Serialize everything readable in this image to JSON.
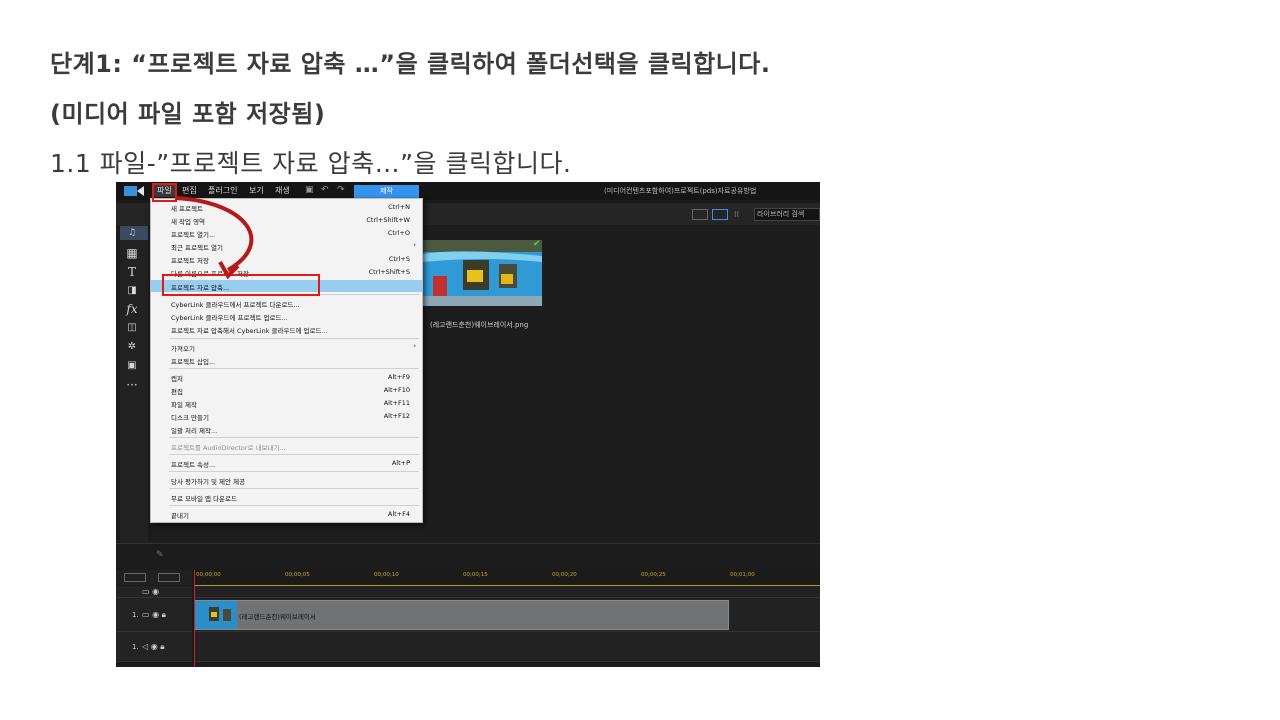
{
  "heading": {
    "line1": "단계1: “프로젝트 자료 압축 …”을 클릭하여 폴더선택을 클릭합니다.",
    "line2": "(미디어 파일 포함 저장됨)",
    "line3": "1.1 파일-”프로젝트 자료 압축…”을 클릭합니다."
  },
  "screenshot": {
    "window_title": "(미디어컨텐츠포함하여)프로젝트(pds)자료공유방법",
    "menubar": {
      "items": [
        {
          "label": "파일",
          "active": true
        },
        {
          "label": "편집"
        },
        {
          "label": "플러그인"
        },
        {
          "label": "보기"
        },
        {
          "label": "재생"
        }
      ],
      "produce_label": "제작"
    },
    "library_search": "라이브러리 검색",
    "media_item": {
      "filename": "(레고랜드춘천)웨이브레이서.png"
    },
    "file_menu": {
      "rows": [
        {
          "label": "새 프로젝트",
          "shortcut": "Ctrl+N"
        },
        {
          "label": "새 작업 영역",
          "shortcut": "Ctrl+Shift+W"
        },
        {
          "label": "프로젝트 열기...",
          "shortcut": "Ctrl+O"
        },
        {
          "label": "최근 프로젝트 열기",
          "shortcut": "",
          "submenu": true
        },
        {
          "label": "프로젝트 저장",
          "shortcut": "Ctrl+S"
        },
        {
          "label": "다른 이름으로 프로젝트 저장...",
          "shortcut": "Ctrl+Shift+S"
        },
        {
          "label": "프로젝트 자료 압축...",
          "shortcut": "",
          "highlighted": true
        },
        {
          "label": "CyberLink 클라우드에서 프로젝트 다운로드...",
          "shortcut": ""
        },
        {
          "label": "CyberLink 클라우드에 프로젝트 업로드...",
          "shortcut": ""
        },
        {
          "label": "프로젝트 자료 압축해서 CyberLink 클라우드에 업로드...",
          "shortcut": ""
        },
        {
          "label": "가져오기",
          "shortcut": "",
          "submenu": true
        },
        {
          "label": "프로젝트 삽입...",
          "shortcut": ""
        },
        {
          "label": "캡처",
          "shortcut": "Alt+F9"
        },
        {
          "label": "편집",
          "shortcut": "Alt+F10"
        },
        {
          "label": "파일 제작",
          "shortcut": "Alt+F11"
        },
        {
          "label": "디스크 만들기",
          "shortcut": "Alt+F12"
        },
        {
          "label": "일괄 처리 제작...",
          "shortcut": ""
        },
        {
          "label": "프로젝트를 AudioDirector로 내보내기...",
          "shortcut": "",
          "disabled": true
        },
        {
          "label": "프로젝트 속성...",
          "shortcut": "Alt+P"
        },
        {
          "label": "당사 평가하기 및 제안 제공",
          "shortcut": ""
        },
        {
          "label": "무료 모바일 앱 다운로드",
          "shortcut": ""
        },
        {
          "label": "끝내기",
          "shortcut": "Alt+F4"
        }
      ]
    },
    "timeline": {
      "ruler_labels": [
        "00;00;00",
        "00;00;05",
        "00;00;10",
        "00;00;15",
        "00;00;20",
        "00;00;25",
        "00;01;00"
      ],
      "track1_label": "1.",
      "track2_label": "1.",
      "clip_label": "(레고랜드춘천)웨이브레이서"
    },
    "colors": {
      "accent": "#3794ec",
      "highlight": "#99cdf0",
      "annotation_red": "#e21a1a"
    }
  }
}
